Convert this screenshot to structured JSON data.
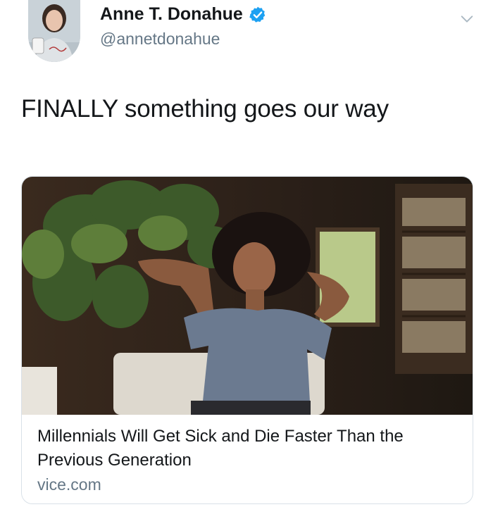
{
  "user": {
    "display_name": "Anne T. Donahue",
    "handle": "@annetdonahue",
    "verified": true,
    "avatar_icon": "profile-photo-icon",
    "verified_icon": "verified-badge-icon"
  },
  "tweet": {
    "text": "FINALLY something goes our way"
  },
  "card": {
    "title": "Millennials Will Get Sick and Die Faster Than the Previous Generation",
    "domain": "vice.com",
    "image_icon": "woman-relaxing-photo"
  },
  "menu_icon": "chevron-down-icon",
  "colors": {
    "verified": "#1da1f2",
    "secondary_text": "#657786",
    "card_border": "#d9e1e8"
  }
}
